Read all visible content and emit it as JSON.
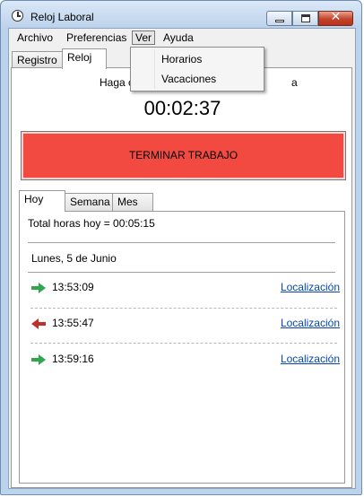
{
  "window": {
    "title": "Reloj Laboral"
  },
  "menubar": {
    "items": [
      "Archivo",
      "Preferencias",
      "Ver",
      "Ayuda"
    ],
    "open": "Ver"
  },
  "dropdown": {
    "items": [
      "Horarios",
      "Vacaciones"
    ]
  },
  "main_tabs": [
    "Registro",
    "Reloj"
  ],
  "active_main_tab": "Reloj",
  "reloj": {
    "hint_left": "Haga c",
    "hint_right": "a",
    "timer": "00:02:37",
    "stop_button": "TERMINAR TRABAJO",
    "stop_color": "#f24a40"
  },
  "sub_tabs": [
    "Hoy",
    "Semana",
    "Mes"
  ],
  "active_sub_tab": "Hoy",
  "hoy": {
    "total": "Total horas hoy = 00:05:15",
    "date": "Lunes, 5 de Junio",
    "entries": [
      {
        "type": "entrada",
        "icon": "arrow-right-green",
        "time": "13:53:09",
        "link": "Localización"
      },
      {
        "type": "salida",
        "icon": "arrow-left-red",
        "time": "13:55:47",
        "link": "Localización"
      },
      {
        "type": "entrada",
        "icon": "arrow-right-green",
        "time": "13:59:16",
        "link": "Localización"
      }
    ]
  },
  "colors": {
    "in_arrow": "#2da84a",
    "out_arrow": "#c0302a",
    "link": "#0645ad"
  }
}
